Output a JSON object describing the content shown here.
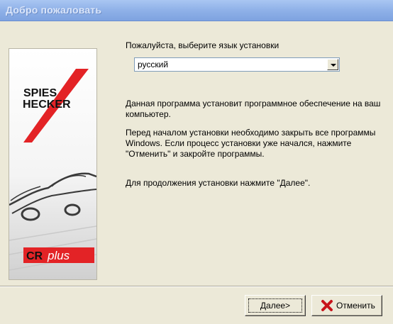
{
  "window": {
    "title": "Добро пожаловать"
  },
  "brand": {
    "logo_line1": "SPIES",
    "logo_line2": "HECKER",
    "product_cr": "CR",
    "product_plus": "plus"
  },
  "language": {
    "prompt": "Пожалуйста, выберите язык установки",
    "selected": "русский"
  },
  "paragraphs": {
    "p1": "Данная программа установит программное обеспечение на ваш компьютер.",
    "p2": "Перед началом установки необходимо закрыть все программы Windows. Если процесс установки уже начался, нажмите \"Отменить\" и закройте программы.",
    "p3": "Для продолжения установки нажмите \"Далее\"."
  },
  "buttons": {
    "next": "Далее>",
    "cancel": "Отменить"
  },
  "colors": {
    "title_bar": "#8fb1e8",
    "logo_red": "#e32326",
    "client_bg": "#ece9d8"
  }
}
